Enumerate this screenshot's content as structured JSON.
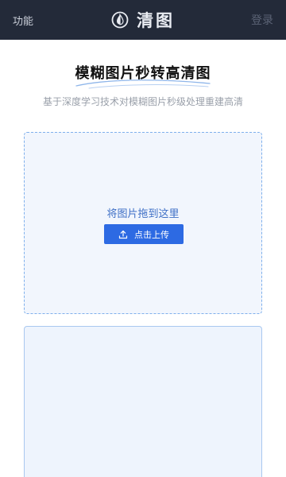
{
  "header": {
    "menu_label": "功能",
    "brand_name": "清图",
    "login_label": "登录",
    "logo_icon": "contrast-drop-icon",
    "background": "#232a39"
  },
  "hero": {
    "title": "模糊图片秒转高清图",
    "subtitle": "基于深度学习技术对模糊图片秒级处理重建高清"
  },
  "upload": {
    "drop_hint": "将图片拖到这里",
    "button_label": "点击上传",
    "button_icon": "upload-icon",
    "accent": "#2d6ae3"
  }
}
